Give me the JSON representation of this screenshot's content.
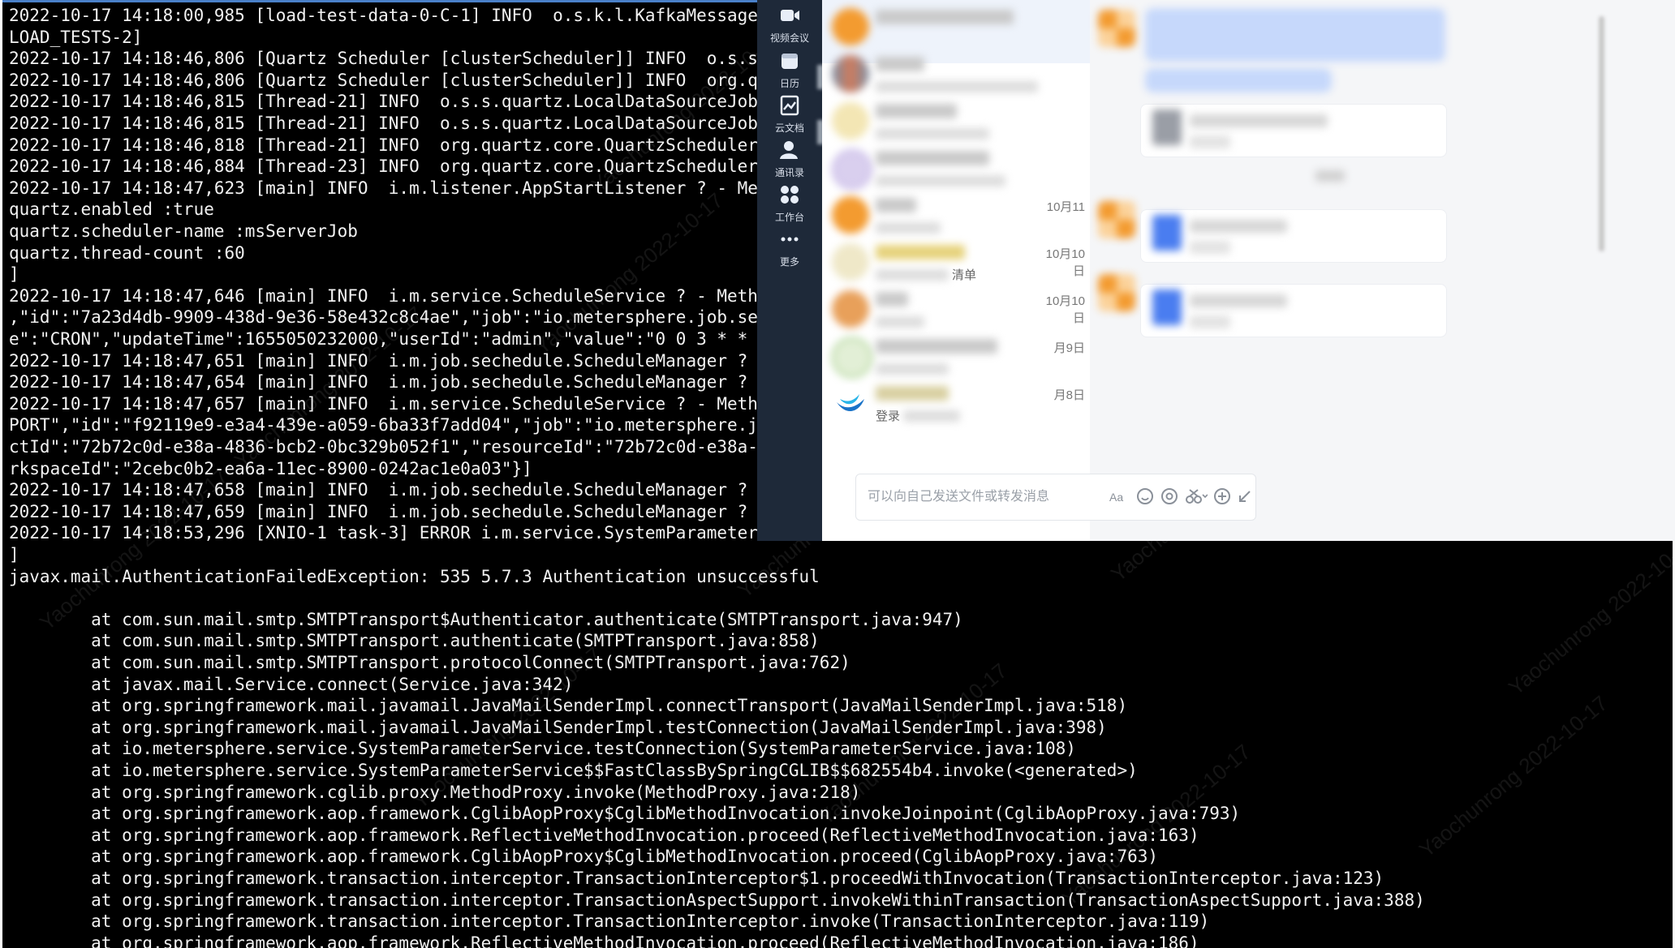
{
  "terminal": {
    "lines": [
      "2022-10-17 14:18:00,985 [load-test-data-0-C-1] INFO  o.s.k.l.KafkaMessage",
      "LOAD_TESTS-2]",
      "2022-10-17 14:18:46,806 [Quartz Scheduler [clusterScheduler]] INFO  o.s.s",
      "2022-10-17 14:18:46,806 [Quartz Scheduler [clusterScheduler]] INFO  org.q",
      "2022-10-17 14:18:46,815 [Thread-21] INFO  o.s.s.quartz.LocalDataSourceJob",
      "2022-10-17 14:18:46,815 [Thread-21] INFO  o.s.s.quartz.LocalDataSourceJob",
      "2022-10-17 14:18:46,818 [Thread-21] INFO  org.quartz.core.QuartzScheduler",
      "2022-10-17 14:18:46,884 [Thread-23] INFO  org.quartz.core.QuartzScheduler",
      "2022-10-17 14:18:47,623 [main] INFO  i.m.listener.AppStartListener ? - Me",
      "quartz.enabled :true",
      "quartz.scheduler-name :msServerJob",
      "quartz.thread-count :60",
      "]",
      "2022-10-17 14:18:47,646 [main] INFO  i.m.service.ScheduleService ? - Meth",
      ",\"id\":\"7a23d4db-9909-438d-9e36-58e432c8c4ae\",\"job\":\"io.metersphere.job.se",
      "e\":\"CRON\",\"updateTime\":1655050232000,\"userId\":\"admin\",\"value\":\"0 0 3 * *",
      "2022-10-17 14:18:47,651 [main] INFO  i.m.job.sechedule.ScheduleManager ?",
      "2022-10-17 14:18:47,654 [main] INFO  i.m.job.sechedule.ScheduleManager ?",
      "2022-10-17 14:18:47,657 [main] INFO  i.m.service.ScheduleService ? - Meth",
      "PORT\",\"id\":\"f92119e9-e3a4-439e-a059-6ba33f7add04\",\"job\":\"io.metersphere.j",
      "ctId\":\"72b72c0d-e38a-4836-bcb2-0bc329b052f1\",\"resourceId\":\"72b72c0d-e38a-",
      "rkspaceId\":\"2cebc0b2-ea6a-11ec-8900-0242ac1e0a03\"}]",
      "2022-10-17 14:18:47,658 [main] INFO  i.m.job.sechedule.ScheduleManager ?",
      "2022-10-17 14:18:47,659 [main] INFO  i.m.job.sechedule.ScheduleManager ?",
      "2022-10-17 14:18:53,296 [XNIO-1 task-3] ERROR i.m.service.SystemParameter",
      "]",
      "javax.mail.AuthenticationFailedException: 535 5.7.3 Authentication unsuccessful",
      "",
      "        at com.sun.mail.smtp.SMTPTransport$Authenticator.authenticate(SMTPTransport.java:947)",
      "        at com.sun.mail.smtp.SMTPTransport.authenticate(SMTPTransport.java:858)",
      "        at com.sun.mail.smtp.SMTPTransport.protocolConnect(SMTPTransport.java:762)",
      "        at javax.mail.Service.connect(Service.java:342)",
      "        at org.springframework.mail.javamail.JavaMailSenderImpl.connectTransport(JavaMailSenderImpl.java:518)",
      "        at org.springframework.mail.javamail.JavaMailSenderImpl.testConnection(JavaMailSenderImpl.java:398)",
      "        at io.metersphere.service.SystemParameterService.testConnection(SystemParameterService.java:108)",
      "        at io.metersphere.service.SystemParameterService$$FastClassBySpringCGLIB$$682554b4.invoke(<generated>)",
      "        at org.springframework.cglib.proxy.MethodProxy.invoke(MethodProxy.java:218)",
      "        at org.springframework.aop.framework.CglibAopProxy$CglibMethodInvocation.invokeJoinpoint(CglibAopProxy.java:793)",
      "        at org.springframework.aop.framework.ReflectiveMethodInvocation.proceed(ReflectiveMethodInvocation.java:163)",
      "        at org.springframework.aop.framework.CglibAopProxy$CglibMethodInvocation.proceed(CglibAopProxy.java:763)",
      "        at org.springframework.transaction.interceptor.TransactionInterceptor$1.proceedWithInvocation(TransactionInterceptor.java:123)",
      "        at org.springframework.transaction.interceptor.TransactionAspectSupport.invokeWithinTransaction(TransactionAspectSupport.java:388)",
      "        at org.springframework.transaction.interceptor.TransactionInterceptor.invoke(TransactionInterceptor.java:119)",
      "        at org.springframework.aop.framework.ReflectiveMethodInvocation.proceed(ReflectiveMethodInvocation.java:186)"
    ]
  },
  "watermark": {
    "text": "Yaochunrong 2022-10-17"
  },
  "chat_app": {
    "nav": [
      {
        "label": "视频会议",
        "icon": "video-meeting-icon"
      },
      {
        "label": "日历",
        "icon": "calendar-icon"
      },
      {
        "label": "云文档",
        "icon": "cloud-docs-icon"
      },
      {
        "label": "通讯录",
        "icon": "contacts-icon"
      },
      {
        "label": "工作台",
        "icon": "workbench-icon"
      },
      {
        "label": "更多",
        "icon": "more-icon"
      }
    ],
    "conversations": [
      {
        "date": "",
        "snippet": ""
      },
      {
        "date": "",
        "snippet": ""
      },
      {
        "date": "",
        "snippet": ""
      },
      {
        "date": "",
        "snippet": ""
      },
      {
        "date": "10月11",
        "snippet": ""
      },
      {
        "date": "10月10日",
        "snippet": "清单"
      },
      {
        "date": "10月10日",
        "snippet": ""
      },
      {
        "date": "月9日",
        "snippet": ""
      },
      {
        "date": "月8日",
        "snippet": "登录"
      }
    ],
    "composer": {
      "placeholder": "可以向自己发送文件或转发消息"
    },
    "colors": {
      "nav_background": "#1e2939",
      "avatar_orange": "#f39b30",
      "bubble_blue": "#c6d8fb",
      "chat_background": "#f5f6f8",
      "terminal_background": "#000000",
      "terminal_text": "#f2f2f2"
    }
  }
}
